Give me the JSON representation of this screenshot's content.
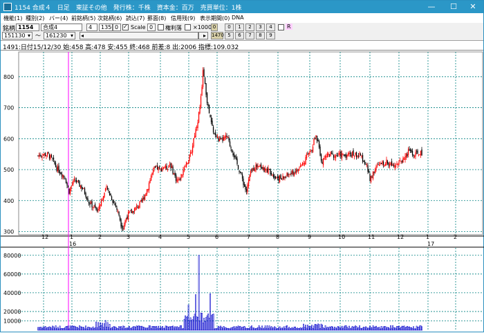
{
  "window": {
    "title": "1154 合成４　日足　東証その他　発行株：千株　資本金：百万　売買単位：1株",
    "minimize": "—",
    "maximize": "☐",
    "close": "✕"
  },
  "menu": [
    "機能(1)",
    "種別(2)",
    "バー(4)",
    "前銘柄(5)",
    "次銘柄(6)",
    "読込(7)",
    "罫面(8)",
    "信用残(9)",
    "表示期間(0)",
    "DNA"
  ],
  "toolbar": {
    "code_label": "銘柄",
    "code_value": "1154",
    "name_value": "合成4",
    "field_a": "4",
    "field_b": "1350",
    "field_c": "0",
    "scale_label": "Scale",
    "field_d": "0",
    "margin_label": "権利落",
    "x1000_label": "×1000",
    "btn_zero_top": "0",
    "btn_1470": "1470",
    "row1_buttons": [
      "0",
      "1",
      "2",
      "3",
      "4"
    ],
    "row2_buttons": [
      "5",
      "6",
      "7",
      "8",
      "9"
    ],
    "r_label": "R",
    "from_date": "151130",
    "to_date": "161230",
    "scroll_left": "◂",
    "scroll_right": "▸"
  },
  "info": {
    "text": "1491:日付15/12/30 始:458 高:478 安:455 終:468 前差:8 出:2006 指標:109.032"
  },
  "price_axis_labels": [
    "800",
    "700",
    "600",
    "500",
    "400",
    "300"
  ],
  "volume_axis_labels": [
    "80000",
    "60000",
    "40000",
    "20000",
    "10000"
  ],
  "month_labels": [
    "12",
    "1",
    "2",
    "3",
    "4",
    "5",
    "6",
    "7",
    "8",
    "9",
    "10",
    "11",
    "12",
    "1",
    "2"
  ],
  "year_labels": [
    "16",
    "17"
  ],
  "colors": {
    "titlebar": "#2b97c7",
    "up_candle": "#ff0000",
    "down_candle": "#000000",
    "grid": "#008080",
    "cursor": "#ff00ff",
    "volume": "#0000cc"
  },
  "chart_data": {
    "type": "candlestick",
    "ylim": [
      290,
      880
    ],
    "y_ticks": [
      800,
      700,
      600,
      500,
      400,
      300
    ],
    "close_path": [
      [
        0,
        545
      ],
      [
        5,
        550
      ],
      [
        10,
        548
      ],
      [
        14,
        530
      ],
      [
        18,
        505
      ],
      [
        22,
        490
      ],
      [
        26,
        475
      ],
      [
        28,
        450
      ],
      [
        30,
        430
      ],
      [
        33,
        455
      ],
      [
        36,
        465
      ],
      [
        40,
        450
      ],
      [
        43,
        440
      ],
      [
        46,
        420
      ],
      [
        49,
        395
      ],
      [
        52,
        385
      ],
      [
        55,
        375
      ],
      [
        57,
        365
      ],
      [
        60,
        395
      ],
      [
        63,
        415
      ],
      [
        66,
        440
      ],
      [
        69,
        425
      ],
      [
        72,
        400
      ],
      [
        75,
        380
      ],
      [
        78,
        355
      ],
      [
        80,
        325
      ],
      [
        82,
        312
      ],
      [
        85,
        345
      ],
      [
        88,
        360
      ],
      [
        91,
        365
      ],
      [
        94,
        375
      ],
      [
        97,
        385
      ],
      [
        100,
        395
      ],
      [
        103,
        420
      ],
      [
        106,
        445
      ],
      [
        109,
        480
      ],
      [
        112,
        500
      ],
      [
        115,
        505
      ],
      [
        118,
        500
      ],
      [
        121,
        510
      ],
      [
        124,
        505
      ],
      [
        127,
        520
      ],
      [
        130,
        495
      ],
      [
        133,
        470
      ],
      [
        136,
        465
      ],
      [
        139,
        490
      ],
      [
        142,
        520
      ],
      [
        145,
        530
      ],
      [
        148,
        560
      ],
      [
        150,
        600
      ],
      [
        152,
        630
      ],
      [
        154,
        660
      ],
      [
        156,
        700
      ],
      [
        158,
        760
      ],
      [
        159,
        830
      ],
      [
        161,
        770
      ],
      [
        163,
        720
      ],
      [
        165,
        680
      ],
      [
        167,
        650
      ],
      [
        169,
        625
      ],
      [
        171,
        610
      ],
      [
        173,
        600
      ],
      [
        176,
        590
      ],
      [
        179,
        600
      ],
      [
        182,
        605
      ],
      [
        185,
        580
      ],
      [
        188,
        555
      ],
      [
        191,
        525
      ],
      [
        194,
        500
      ],
      [
        197,
        470
      ],
      [
        199,
        445
      ],
      [
        201,
        430
      ],
      [
        204,
        480
      ],
      [
        207,
        500
      ],
      [
        210,
        510
      ],
      [
        213,
        520
      ],
      [
        216,
        505
      ],
      [
        219,
        495
      ],
      [
        222,
        500
      ],
      [
        225,
        490
      ],
      [
        228,
        480
      ],
      [
        231,
        475
      ],
      [
        234,
        470
      ],
      [
        237,
        475
      ],
      [
        240,
        480
      ],
      [
        243,
        485
      ],
      [
        246,
        490
      ],
      [
        249,
        495
      ],
      [
        252,
        505
      ],
      [
        255,
        520
      ],
      [
        258,
        535
      ],
      [
        261,
        555
      ],
      [
        264,
        570
      ],
      [
        266,
        595
      ],
      [
        268,
        610
      ],
      [
        270,
        585
      ],
      [
        272,
        545
      ],
      [
        274,
        525
      ],
      [
        277,
        540
      ],
      [
        280,
        550
      ],
      [
        283,
        548
      ],
      [
        286,
        545
      ],
      [
        289,
        545
      ],
      [
        292,
        548
      ],
      [
        295,
        546
      ],
      [
        298,
        548
      ],
      [
        301,
        552
      ],
      [
        304,
        550
      ],
      [
        307,
        548
      ],
      [
        310,
        545
      ],
      [
        313,
        535
      ],
      [
        316,
        520
      ],
      [
        318,
        495
      ],
      [
        320,
        470
      ],
      [
        323,
        490
      ],
      [
        326,
        505
      ],
      [
        329,
        515
      ],
      [
        332,
        520
      ],
      [
        335,
        525
      ],
      [
        338,
        520
      ],
      [
        341,
        518
      ],
      [
        344,
        520
      ],
      [
        347,
        522
      ],
      [
        350,
        525
      ],
      [
        353,
        540
      ],
      [
        356,
        550
      ],
      [
        358,
        565
      ],
      [
        360,
        555
      ],
      [
        362,
        545
      ],
      [
        365,
        550
      ],
      [
        368,
        555
      ],
      [
        370,
        550
      ]
    ],
    "volume_spikes": [
      [
        145,
        27000
      ],
      [
        152,
        38000
      ],
      [
        155,
        80000
      ],
      [
        166,
        39000
      ]
    ],
    "volume_ylim": [
      0,
      85000
    ]
  }
}
